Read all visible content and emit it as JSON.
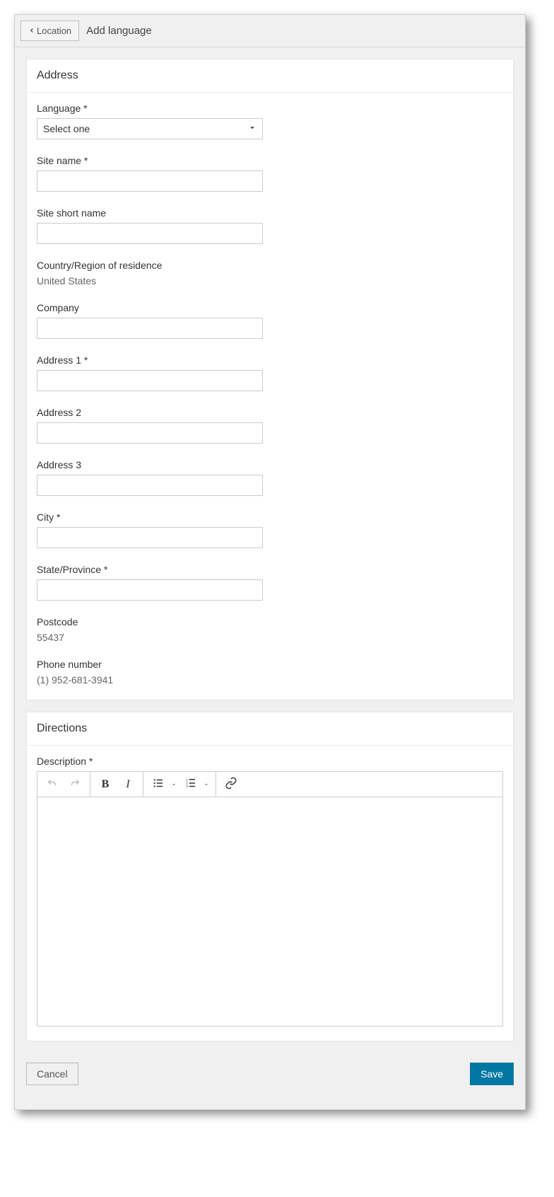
{
  "header": {
    "back_label": "Location",
    "title": "Add language"
  },
  "sections": {
    "address": {
      "title": "Address",
      "language_label": "Language *",
      "language_placeholder": "Select one",
      "site_name_label": "Site name *",
      "site_short_name_label": "Site short name",
      "country_label": "Country/Region of residence",
      "country_value": "United States",
      "company_label": "Company",
      "address1_label": "Address 1 *",
      "address2_label": "Address 2",
      "address3_label": "Address 3",
      "city_label": "City *",
      "state_label": "State/Province *",
      "postcode_label": "Postcode",
      "postcode_value": "55437",
      "phone_label": "Phone number",
      "phone_value": "(1) 952-681-3941"
    },
    "directions": {
      "title": "Directions",
      "description_label": "Description *"
    }
  },
  "footer": {
    "cancel_label": "Cancel",
    "save_label": "Save"
  }
}
